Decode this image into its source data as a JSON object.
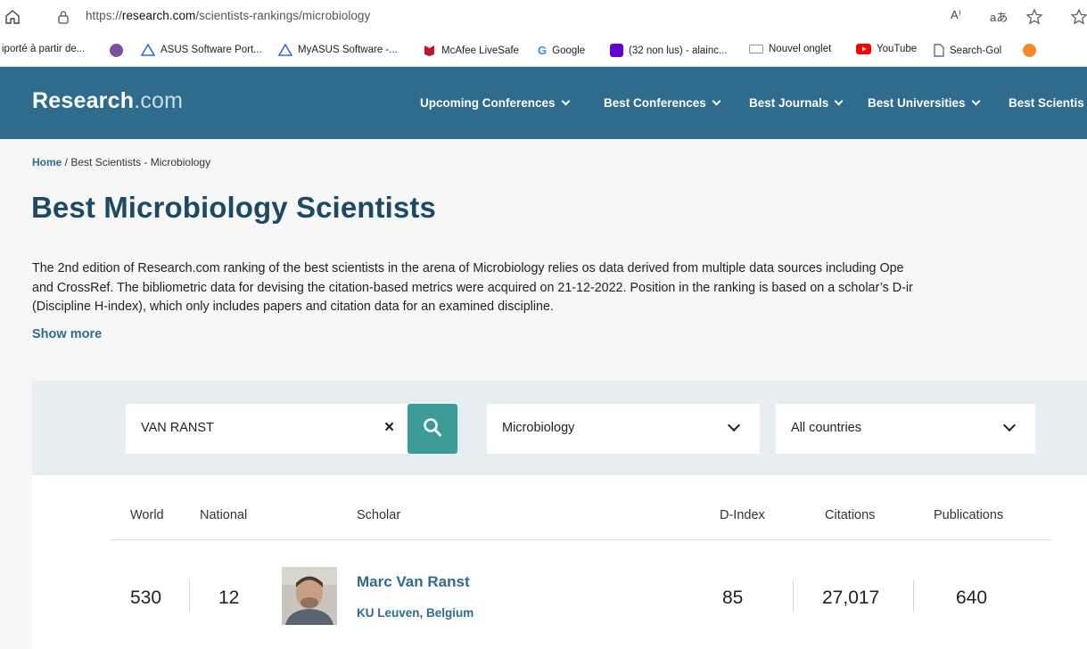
{
  "browser": {
    "url_prefix": "https://",
    "url_domain": "research.com",
    "url_path": "/scientists-rankings/microbiology",
    "read_aloud_label": "A⁾",
    "translate_label": "aあ"
  },
  "bookmarks": [
    {
      "label": "iporté à partir de...",
      "icon": "folder-icon"
    },
    {
      "label": "",
      "icon": "wikipedia-icon",
      "color": "#7a4f9e"
    },
    {
      "label": "ASUS Software Port...",
      "icon": "asus-icon",
      "color": "#2a6fdb"
    },
    {
      "label": "MyASUS Software -...",
      "icon": "asus-icon",
      "color": "#2a6fdb"
    },
    {
      "label": "McAfee LiveSafe",
      "icon": "mcafee-icon",
      "color": "#c0162c"
    },
    {
      "label": "Google",
      "icon": "google-icon",
      "color": "#4285f4"
    },
    {
      "label": "(32 non lus) - alainc...",
      "icon": "yahoo-mail-icon",
      "color": "#6001d2"
    },
    {
      "label": "Nouvel onglet",
      "icon": "new-tab-icon",
      "color": "#999999"
    },
    {
      "label": "YouTube",
      "icon": "youtube-icon",
      "color": "#ff0000"
    },
    {
      "label": "Search-Gol",
      "icon": "page-icon",
      "color": "#555555"
    },
    {
      "label": "",
      "icon": "extension-icon",
      "color": "#f08a2c"
    }
  ],
  "site": {
    "logo_main": "Research",
    "logo_tld": ".com",
    "nav": [
      "Upcoming Conferences",
      "Best Conferences",
      "Best Journals",
      "Best Universities",
      "Best Scientis"
    ]
  },
  "breadcrumb": {
    "home": "Home",
    "separator": " / ",
    "current": "Best Scientists - Microbiology"
  },
  "page_title": "Best Microbiology Scientists",
  "description_lines": [
    "The 2nd edition of Research.com ranking of the best scientists in the arena of Microbiology relies os data derived from multiple data sources including Ope",
    "and CrossRef. The bibliometric data for devising the citation-based metrics were acquired on 21-12-2022. Position in the ranking is based on a scholar’s D-ir",
    "(Discipline H-index), which only includes papers and citation data for an examined discipline."
  ],
  "show_more": "Show more",
  "filters": {
    "search_value": "VAN RANST",
    "clear_symbol": "×",
    "discipline": "Microbiology",
    "country": "All countries"
  },
  "table": {
    "headers": {
      "world": "World",
      "national": "National",
      "scholar": "Scholar",
      "dindex": "D-Index",
      "citations": "Citations",
      "publications": "Publications"
    },
    "rows": [
      {
        "world": "530",
        "national": "12",
        "name": "Marc Van Ranst",
        "affiliation": "KU Leuven, Belgium",
        "dindex": "85",
        "citations": "27,017",
        "publications": "640"
      }
    ]
  },
  "colors": {
    "header_bg": "#2f6b8c",
    "title": "#1c4a66",
    "link": "#2f6b8c",
    "search_btn": "#3d9b97",
    "filter_bg": "#e6eef1"
  }
}
